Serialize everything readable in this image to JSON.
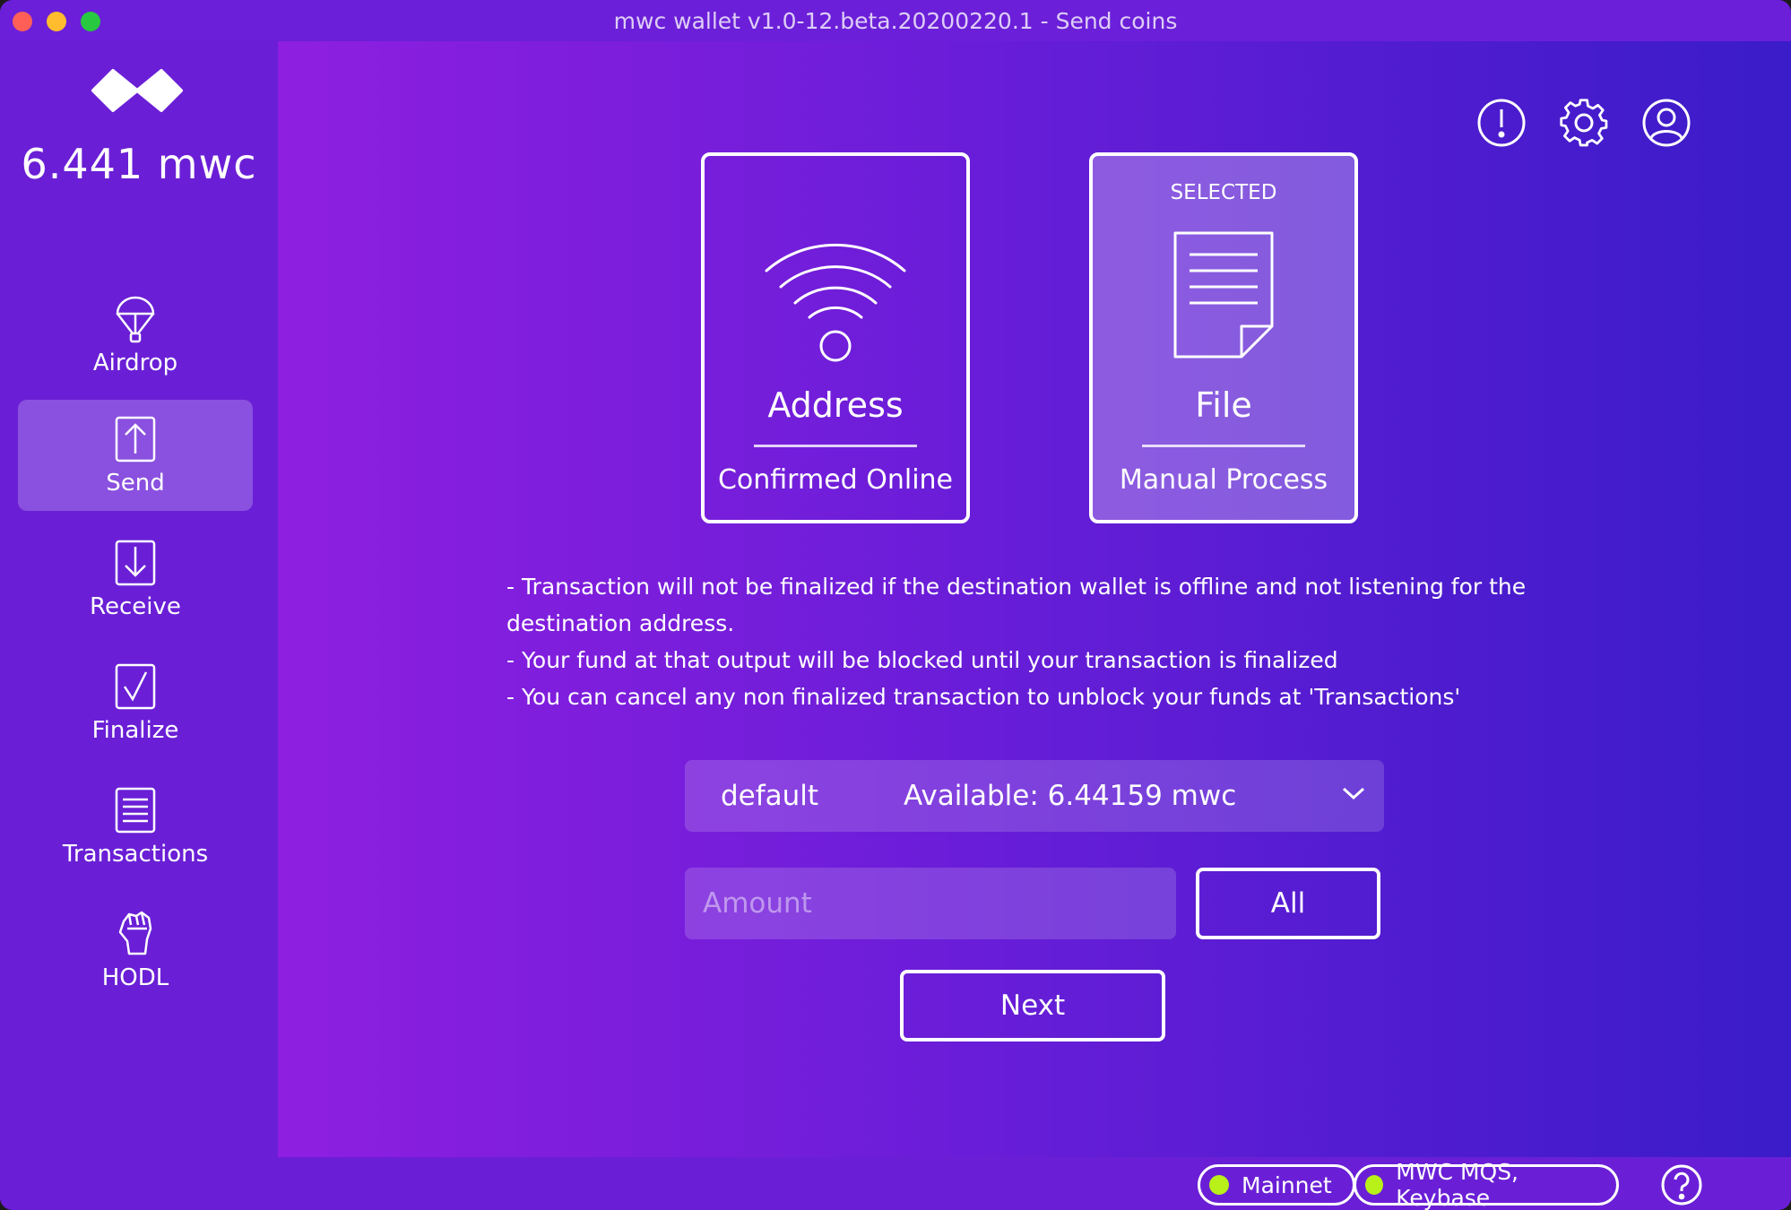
{
  "window": {
    "title": "mwc wallet v1.0-12.beta.20200220.1 - Send coins"
  },
  "sidebar": {
    "balance": "6.441 mwc",
    "items": [
      {
        "label": "Airdrop",
        "icon": "parachute-icon"
      },
      {
        "label": "Send",
        "icon": "arrow-up-box-icon",
        "active": true
      },
      {
        "label": "Receive",
        "icon": "arrow-down-box-icon"
      },
      {
        "label": "Finalize",
        "icon": "checkbox-icon"
      },
      {
        "label": "Transactions",
        "icon": "list-doc-icon"
      },
      {
        "label": "HODL",
        "icon": "raised-fist-icon"
      }
    ]
  },
  "top_icons": [
    "alert-icon",
    "gear-icon",
    "account-icon"
  ],
  "methods": [
    {
      "title": "Address",
      "subtitle": "Confirmed Online",
      "icon": "wifi-icon",
      "selected": false,
      "badge": ""
    },
    {
      "title": "File",
      "subtitle": "Manual Process",
      "icon": "document-icon",
      "selected": true,
      "badge": "SELECTED"
    }
  ],
  "notes": [
    "- Transaction will not be finalized if the destination wallet is offline and not listening for the destination address.",
    "- Your fund at that output will be blocked until your transaction is finalized",
    "- You can cancel any non finalized transaction to unblock your funds at 'Transactions'"
  ],
  "account": {
    "name": "default",
    "available": "Available: 6.44159 mwc"
  },
  "amount": {
    "placeholder": "Amount",
    "value": ""
  },
  "buttons": {
    "all": "All",
    "next": "Next"
  },
  "status": {
    "network": "Mainnet",
    "listeners": "MWC MQS, Keybase",
    "indicator_color": "#b8f01a"
  },
  "colors": {
    "sidebar_bg": "#6a1fd6",
    "gradient_start": "#8e1fe0",
    "gradient_end": "#3a1cc8"
  }
}
